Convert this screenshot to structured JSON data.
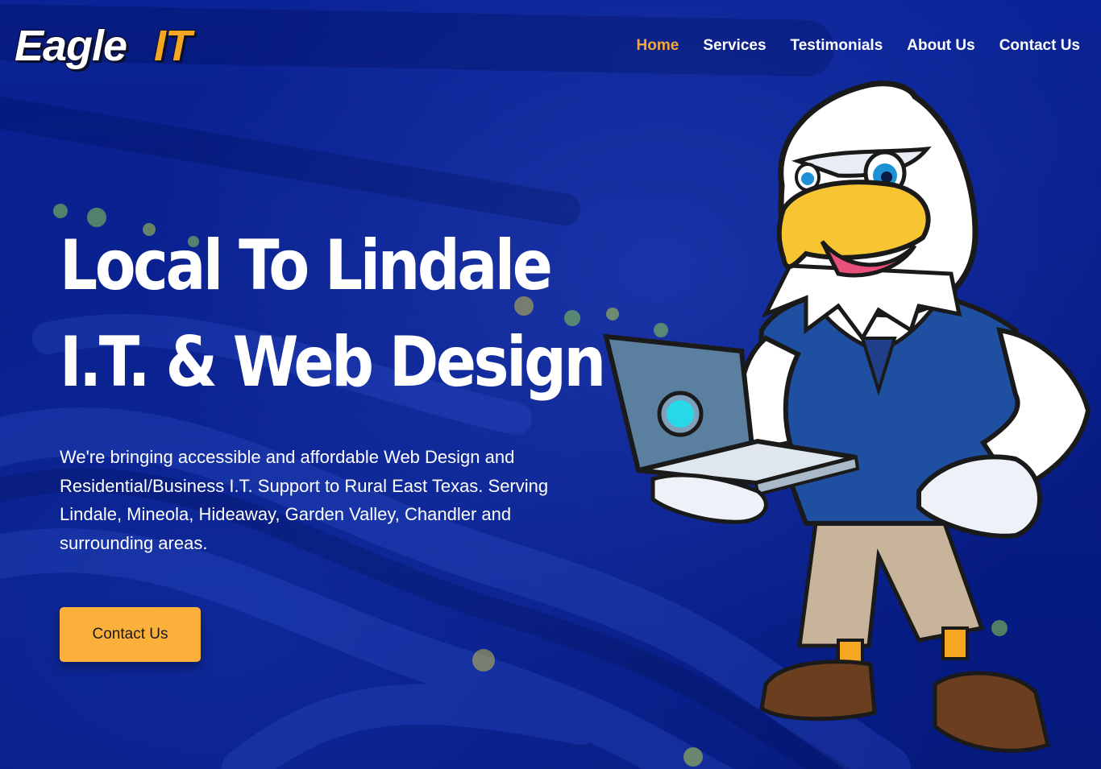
{
  "brand": {
    "logo_word": "Eagle",
    "logo_accent": "IT",
    "accent_color": "#f5a838",
    "cta_color": "#fbb03b",
    "background_color": "#06208a"
  },
  "nav": {
    "items": [
      {
        "label": "Home",
        "active": true
      },
      {
        "label": "Services",
        "active": false
      },
      {
        "label": "Testimonials",
        "active": false
      },
      {
        "label": "About Us",
        "active": false
      },
      {
        "label": "Contact Us",
        "active": false
      }
    ]
  },
  "hero": {
    "headline_line1": "Local To Lindale",
    "headline_line2": "I.T. & Web Design",
    "subtext": "We're bringing accessible and affordable Web Design and Residential/Business I.T. Support to Rural East Texas. Serving Lindale, Mineola, Hideaway, Garden Valley, Chandler and surrounding areas.",
    "cta_label": "Contact Us"
  },
  "icons": {
    "mascot": "eagle-mascot-with-laptop"
  }
}
